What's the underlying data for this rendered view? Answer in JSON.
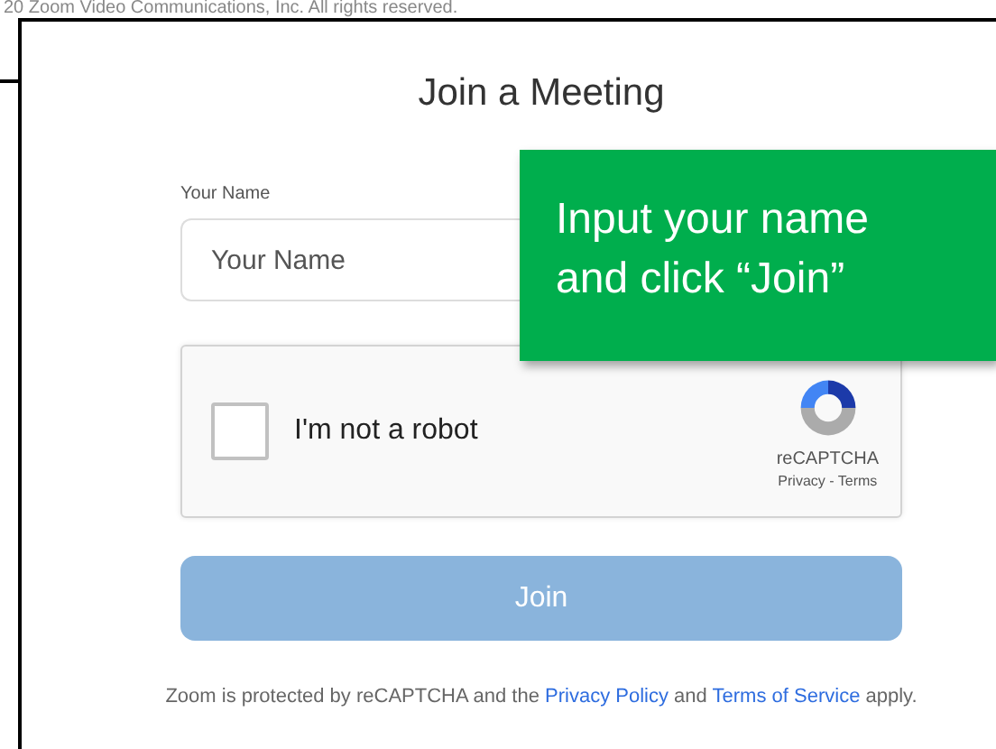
{
  "copyright": "20 Zoom Video Communications, Inc. All rights reserved.",
  "title": "Join a Meeting",
  "name_field": {
    "label": "Your Name",
    "placeholder": "Your Name"
  },
  "captcha": {
    "label": "I'm not a robot",
    "checked": false,
    "brand": "reCAPTCHA",
    "links": "Privacy - Terms"
  },
  "join_button": {
    "label": "Join",
    "disabled": true
  },
  "footer": {
    "parts": [
      {
        "kind": "text",
        "text": "Zoom is protected by reCAPTCHA and the "
      },
      {
        "kind": "link",
        "text": "Privacy Policy"
      },
      {
        "kind": "text",
        "text": " and "
      },
      {
        "kind": "link",
        "text": "Terms of Service"
      },
      {
        "kind": "text",
        "text": " apply."
      }
    ]
  },
  "callout": {
    "text": "Input your name and click “Join”"
  }
}
